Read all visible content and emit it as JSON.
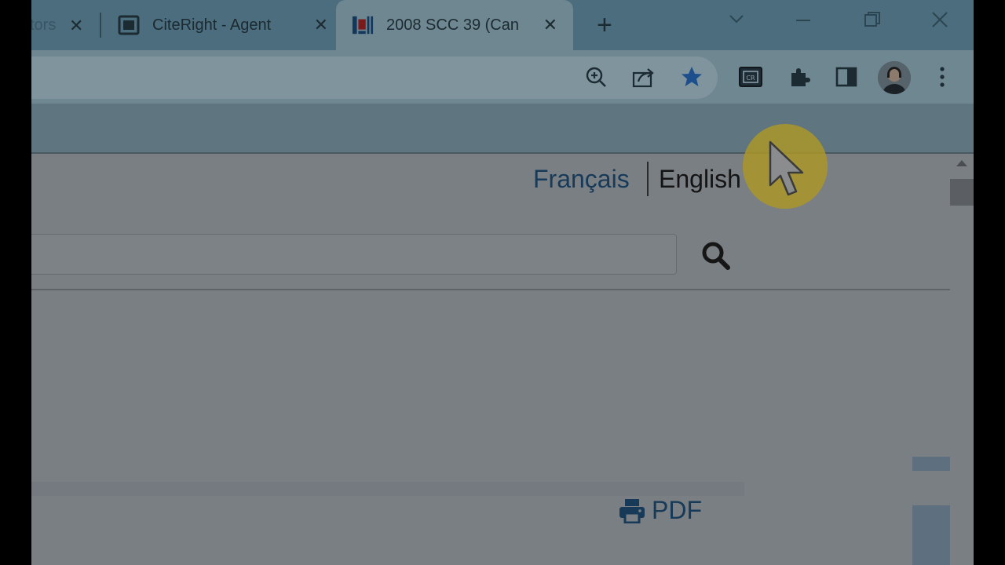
{
  "tabs": [
    {
      "label": "tors",
      "close": "✕"
    },
    {
      "label": "CiteRight - Agent",
      "close": "✕"
    },
    {
      "label": "2008 SCC 39 (Can",
      "close": "✕"
    }
  ],
  "new_tab": "+",
  "window_controls": {
    "list": "⌵",
    "minimize": "—",
    "restore": "❐",
    "close": "✕"
  },
  "toolbar": {
    "icons": [
      "zoom-icon",
      "share-icon",
      "bookmark-star-icon",
      "citeright-extension-icon",
      "extensions-icon",
      "side-panel-icon",
      "profile-avatar",
      "menu-icon"
    ],
    "citeright_badge": "CR"
  },
  "page": {
    "lang_french": "Français",
    "lang_english": "English",
    "search_placeholder": "",
    "pdf_label": "PDF"
  },
  "colors": {
    "tab_active": "#6e8791",
    "tab_strip": "#4b6d7d",
    "link": "#163a58",
    "star": "#1c4f8c",
    "cursor_highlight": "#aa9628"
  }
}
